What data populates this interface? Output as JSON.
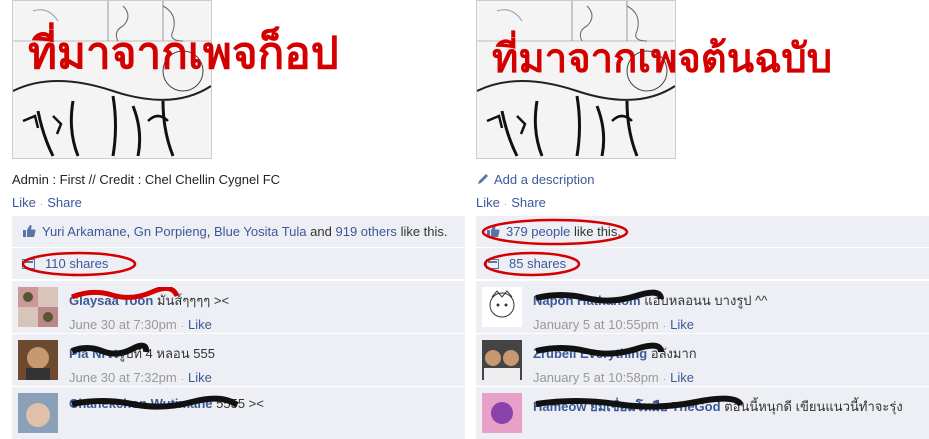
{
  "left": {
    "overlay_text": "ที่มาจากเพจก็อป",
    "caption": "Admin : First // Credit : Chel Chellin Cygnel FC",
    "like_label": "Like",
    "share_label": "Share",
    "likers": [
      "Yuri Arkamane",
      "Gn Porpieng",
      "Blue Yosita Tula"
    ],
    "likers_and": "and",
    "others": "919 others",
    "like_suffix": "like this.",
    "shares": "110 shares",
    "comments": [
      {
        "name": "Glaysaa Toon",
        "text": "มันส์ๆๆๆๆ ><",
        "time": "June 30 at 7:30pm",
        "like": "Like"
      },
      {
        "name": "Pla Nrvt",
        "text": "รูปที่ 4 หลอน 555",
        "time": "June 30 at 7:32pm",
        "like": "Like"
      },
      {
        "name": "Chanekchon Wutimane",
        "text": "5555 ><",
        "time": "",
        "like": ""
      }
    ]
  },
  "right": {
    "overlay_text": "ที่มาจากเพจต้นฉบับ",
    "caption": "Add a description",
    "like_label": "Like",
    "share_label": "Share",
    "people": "379 people",
    "like_suffix": "like this.",
    "shares": "85 shares",
    "comments": [
      {
        "name": "Napon Hathanom",
        "text": "แอบหลอนน บางรูป ^^",
        "time": "January 5 at 10:55pm",
        "like": "Like"
      },
      {
        "name": "Zrubell Everything",
        "text": "อลังมาก",
        "time": "January 5 at 10:58pm",
        "like": "Like"
      },
      {
        "name": "Hameow ยมีเชื่อมโหมือ TheGod",
        "text": "ตอนนี้หนุกดี เขียนแนวนี้ทำจะรุ่ง",
        "time": "",
        "like": ""
      }
    ]
  },
  "colors": {
    "link": "#3b5998",
    "panel": "#edeff4",
    "annotation": "#d40000"
  }
}
